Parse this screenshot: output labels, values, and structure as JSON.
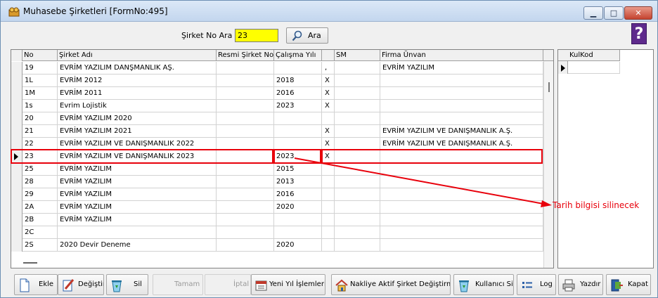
{
  "window": {
    "title": "Muhasebe Şirketleri [FormNo:495]"
  },
  "search": {
    "label": "Şirket No Ara",
    "value": "23",
    "button_label": "Ara"
  },
  "help": {
    "label": "?"
  },
  "grid": {
    "columns": [
      "No",
      "Şirket Adı",
      "Resmi Şirket No",
      "Çalışma Yılı",
      "",
      "SM",
      "Firma Ünvan"
    ],
    "rows": [
      {
        "no": "19",
        "name": "EVRİM YAZILIM DANŞMANLIK AŞ.",
        "resmi": "",
        "year": "",
        "flag": ",",
        "sm": "",
        "firma": "EVRİM YAZILIM"
      },
      {
        "no": "1L",
        "name": "EVRİM 2012",
        "resmi": "",
        "year": "2018",
        "flag": "X",
        "sm": "",
        "firma": ""
      },
      {
        "no": "1M",
        "name": "EVRİM 2011",
        "resmi": "",
        "year": "2016",
        "flag": "X",
        "sm": "",
        "firma": ""
      },
      {
        "no": "1s",
        "name": "Evrim Lojistik",
        "resmi": "",
        "year": "2023",
        "flag": "X",
        "sm": "",
        "firma": ""
      },
      {
        "no": "20",
        "name": "EVRİM YAZILIM  2020",
        "resmi": "",
        "year": "",
        "flag": "",
        "sm": "",
        "firma": ""
      },
      {
        "no": "21",
        "name": "EVRİM YAZILIM  2021",
        "resmi": "",
        "year": "",
        "flag": "X",
        "sm": "",
        "firma": "EVRİM YAZILIM VE DANIŞMANLIK A.Ş."
      },
      {
        "no": "22",
        "name": "EVRİM YAZILIM  VE DANIŞMANLIK 2022",
        "resmi": "",
        "year": "",
        "flag": "X",
        "sm": "",
        "firma": "EVRİM YAZILIM VE DANIŞMANLIK A.Ş."
      },
      {
        "no": "23",
        "name": "EVRİM YAZILIM  VE DANIŞMANLIK 2023",
        "resmi": "",
        "year": "2023",
        "flag": "X",
        "sm": "",
        "firma": ""
      },
      {
        "no": "25",
        "name": "EVRİM YAZILIM",
        "resmi": "",
        "year": "2015",
        "flag": "",
        "sm": "",
        "firma": ""
      },
      {
        "no": "28",
        "name": "EVRİM YAZILIM",
        "resmi": "",
        "year": "2013",
        "flag": "",
        "sm": "",
        "firma": ""
      },
      {
        "no": "29",
        "name": "EVRİM YAZILIM",
        "resmi": "",
        "year": "2016",
        "flag": "",
        "sm": "",
        "firma": ""
      },
      {
        "no": "2A",
        "name": "EVRİM YAZILIM",
        "resmi": "",
        "year": "2020",
        "flag": "",
        "sm": "",
        "firma": ""
      },
      {
        "no": "2B",
        "name": "EVRİM YAZILIM",
        "resmi": "",
        "year": "",
        "flag": "",
        "sm": "",
        "firma": ""
      },
      {
        "no": "2C",
        "name": "",
        "resmi": "",
        "year": "",
        "flag": "",
        "sm": "",
        "firma": ""
      },
      {
        "no": "2S",
        "name": "2020 Devir Deneme",
        "resmi": "",
        "year": "2020",
        "flag": "",
        "sm": "",
        "firma": ""
      }
    ]
  },
  "side_grid": {
    "column": "KulKod"
  },
  "annotation": {
    "text": "Tarih bilgisi silinecek",
    "color": "#e8000b"
  },
  "toolbar": {
    "ekle": "Ekle",
    "degistir": "Değiştir",
    "sil": "Sil",
    "tamam": "Tamam",
    "iptal": "İptal",
    "yeni_yil": "Yeni Yıl İşlemleri",
    "nakliye": "Nakliye Aktif Şirket Değiştirme",
    "kullanici_sil": "Kullanıcı Sil",
    "log": "Log",
    "yazdir": "Yazdır",
    "kapat": "Kapat"
  },
  "colors": {
    "search_bg": "#ffff00",
    "highlight": "#e8000b",
    "help_bg": "#5e2a8c"
  }
}
